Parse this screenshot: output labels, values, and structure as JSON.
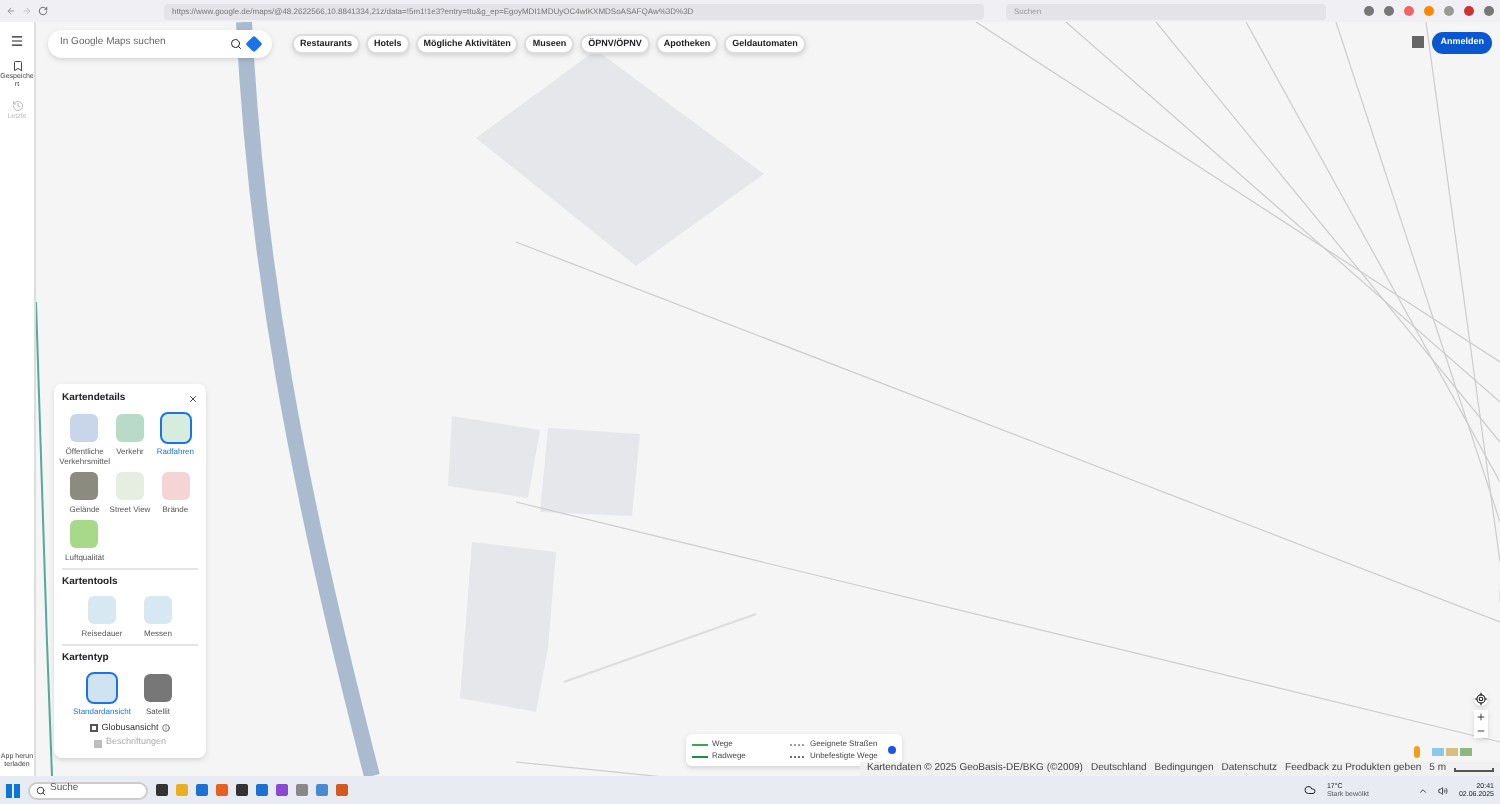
{
  "browser": {
    "url": "https://www.google.de/maps/@48.2622566,10.8841334,21z/data=!5m1!1e3?entry=ttu&g_ep=EgoyMDI1MDUyOC4wIKXMDSoASAFQAw%3D%3D",
    "search_placeholder": "Suchen"
  },
  "sidebar": {
    "items": [
      {
        "label": "Gespeichert",
        "disabled": false
      },
      {
        "label": "Letzte",
        "disabled": true
      }
    ],
    "bottom": "App herunterladen"
  },
  "search": {
    "placeholder": "In Google Maps suchen"
  },
  "chips": [
    {
      "label": "Restaurants"
    },
    {
      "label": "Hotels"
    },
    {
      "label": "Mögliche Aktivitäten"
    },
    {
      "label": "Museen"
    },
    {
      "label": "ÖPNV/ÖPNV"
    },
    {
      "label": "Apotheken"
    },
    {
      "label": "Geldautomaten"
    }
  ],
  "sign_in": "Anmelden",
  "layers_panel": {
    "sections": [
      {
        "title": "Kartendetails",
        "items": [
          {
            "label": "Öffentliche Verkehrsmittel",
            "selected": false
          },
          {
            "label": "Verkehr",
            "selected": false
          },
          {
            "label": "Radfahren",
            "selected": true
          },
          {
            "label": "Gelände",
            "selected": false
          },
          {
            "label": "Street View",
            "selected": false
          },
          {
            "label": "Brände",
            "selected": false
          },
          {
            "label": "Luftqualität",
            "selected": false
          }
        ]
      },
      {
        "title": "Kartentools",
        "items": [
          {
            "label": "Reisedauer",
            "selected": false
          },
          {
            "label": "Messen",
            "selected": false
          }
        ]
      },
      {
        "title": "Kartentyp",
        "items": [
          {
            "label": "Standardansicht",
            "selected": true
          },
          {
            "label": "Satellit",
            "selected": false
          }
        ]
      }
    ],
    "options": [
      {
        "label": "Globusansicht",
        "checked": false,
        "disabled": false
      },
      {
        "label": "Beschriftungen",
        "checked": true,
        "disabled": true
      }
    ]
  },
  "legend": [
    {
      "label": "Wege",
      "color": "#34a853",
      "dashed": false
    },
    {
      "label": "Geeignete Straßen",
      "color": "#9e9e9e",
      "dashed": true
    },
    {
      "label": "Radwege",
      "color": "#1e8e3e",
      "dashed": false
    },
    {
      "label": "Unbefestigte Wege",
      "color": "#6d6d6d",
      "dashed": true
    }
  ],
  "footer": [
    "Kartendaten © 2025 GeoBasis-DE/BKG (©2009)",
    "Deutschland",
    "Bedingungen",
    "Datenschutz",
    "Feedback zu Produkten geben",
    "5 m"
  ],
  "taskbar": {
    "search": "Suche",
    "weather_temp": "17°C",
    "weather_desc": "Stark bewölkt",
    "time": "20:41",
    "date": "02.06.2025"
  }
}
